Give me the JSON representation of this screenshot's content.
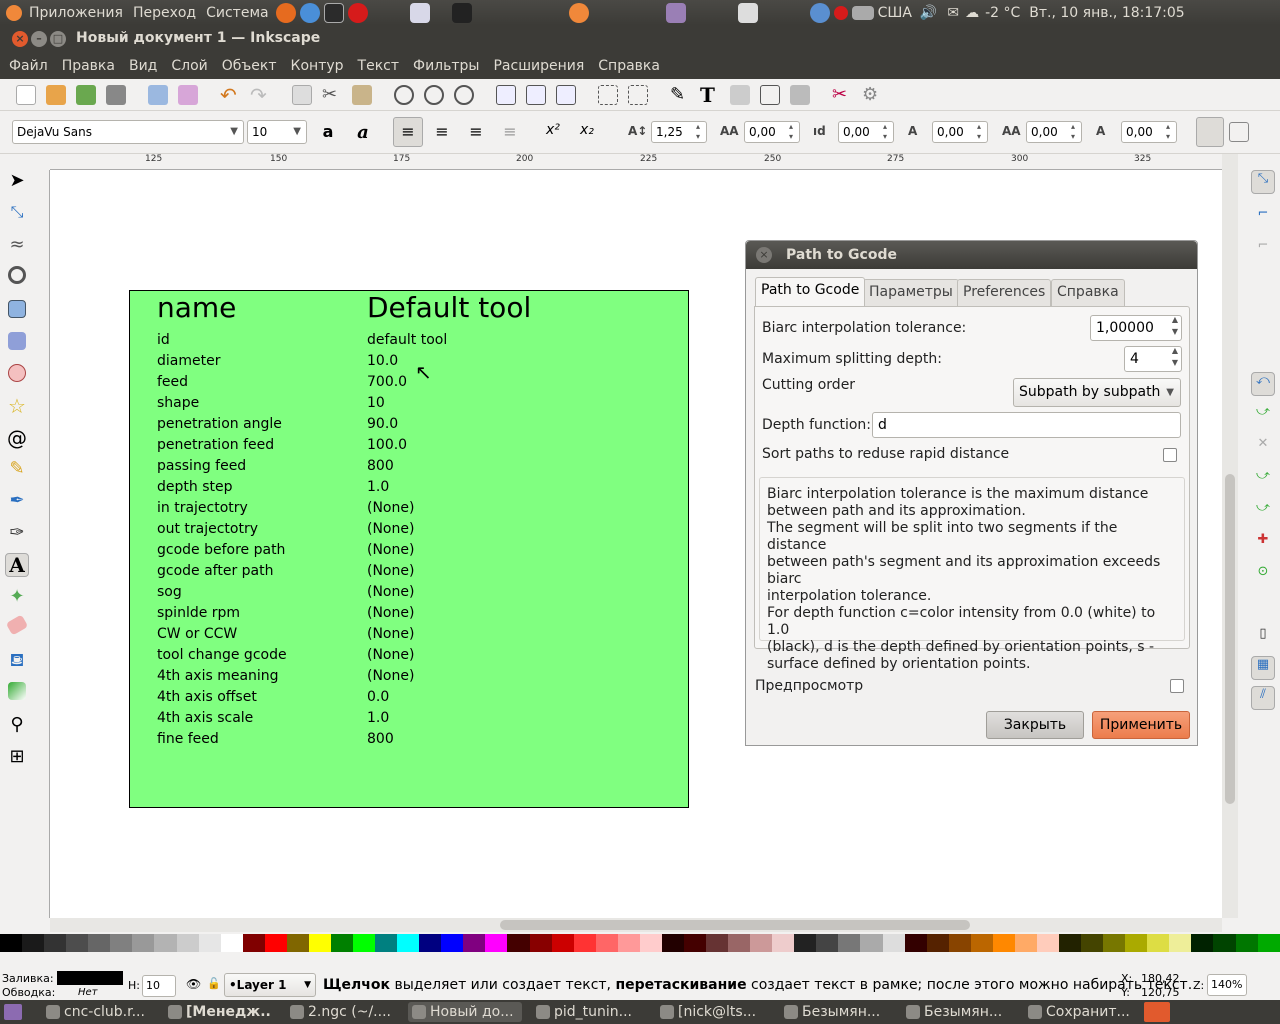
{
  "top_panel": {
    "menus": [
      "Приложения",
      "Переход",
      "Система"
    ],
    "keyboard_layout": "США",
    "weather": "-2 °C",
    "datetime": "Вт., 10 янв., 18:17:05"
  },
  "window": {
    "title": "Новый документ 1 — Inkscape"
  },
  "menubar": [
    "Файл",
    "Правка",
    "Вид",
    "Слой",
    "Объект",
    "Контур",
    "Текст",
    "Фильтры",
    "Расширения",
    "Справка"
  ],
  "textbar": {
    "font_family": "DejaVu Sans",
    "font_size": "10",
    "line_spacing": "1,25",
    "letter_spacing": "0,00",
    "word_spacing": "0,00",
    "kerning": "0,00",
    "vertical_shift": "0,00",
    "rotation": "0,00"
  },
  "ruler_ticks": [
    "125",
    "150",
    "175",
    "200",
    "225",
    "250",
    "275",
    "300",
    "325"
  ],
  "canvas": {
    "header": {
      "name": "name",
      "value": "Default tool"
    },
    "rows": [
      {
        "k": "id",
        "v": "default tool"
      },
      {
        "k": "diameter",
        "v": "10.0"
      },
      {
        "k": "feed",
        "v": "700.0"
      },
      {
        "k": "shape",
        "v": "10"
      },
      {
        "k": "penetration angle",
        "v": "90.0"
      },
      {
        "k": "penetration feed",
        "v": "100.0"
      },
      {
        "k": "passing feed",
        "v": "800"
      },
      {
        "k": "depth step",
        "v": "1.0"
      },
      {
        "k": "in trajectotry",
        "v": "(None)"
      },
      {
        "k": "out trajectotry",
        "v": "(None)"
      },
      {
        "k": "gcode before path",
        "v": "(None)"
      },
      {
        "k": "gcode after path",
        "v": "(None)"
      },
      {
        "k": "sog",
        "v": "(None)"
      },
      {
        "k": "spinlde rpm",
        "v": "(None)"
      },
      {
        "k": "CW or CCW",
        "v": "(None)"
      },
      {
        "k": "tool change gcode",
        "v": "(None)"
      },
      {
        "k": "4th axis meaning",
        "v": "(None)"
      },
      {
        "k": "4th axis offset",
        "v": "0.0"
      },
      {
        "k": "4th axis scale",
        "v": "1.0"
      },
      {
        "k": "fine feed",
        "v": "800"
      }
    ]
  },
  "dialog": {
    "title": "Path to Gcode",
    "tabs": [
      "Path to Gcode",
      "Параметры",
      "Preferences",
      "Справка"
    ],
    "biarc_label": "Biarc interpolation tolerance:",
    "biarc_value": "1,00000",
    "split_label": "Maximum splitting depth:",
    "split_value": "4",
    "order_label": "Cutting order",
    "order_value": "Subpath by subpath",
    "depth_label": "Depth function:",
    "depth_value": "d",
    "sort_label": "Sort paths to reduse rapid distance",
    "help_lines": [
      "Biarc interpolation tolerance is the maximum distance",
      "between path and its approximation.",
      "The segment will be split into two segments if the distance",
      "between path's segment and its approximation exceeds biarc",
      "interpolation tolerance.",
      "For depth function c=color intensity from 0.0 (white) to 1.0",
      "(black), d is the depth defined by orientation points, s -",
      "surface defined by orientation points."
    ],
    "preview_label": "Предпросмотр",
    "close_label": "Закрыть",
    "apply_label": "Применить"
  },
  "status": {
    "fill_label": "Заливка:",
    "stroke_label": "Обводка:",
    "stroke_value": "Нет",
    "opacity_label": "Н:",
    "opacity_value": "10",
    "layer": "•Layer 1",
    "msg_bold1": "Щелчок",
    "msg1": " выделяет или создает текст, ",
    "msg_bold2": "перетаскивание",
    "msg2": " создает текст в рамке; после этого можно набирать текст.",
    "x_label": "X:",
    "x_value": "180,42",
    "y_label": "Y:",
    "y_value": "120,75",
    "zoom_label": "Z:",
    "zoom_value": "140%"
  },
  "taskbar": [
    "cnc-club.r...",
    "[Менедж...",
    "2.ngc (~/....",
    "Новый до...",
    "pid_tunin...",
    "[nick@lts...",
    "Безымян...",
    "Безымян...",
    "Сохранит..."
  ],
  "colors": {
    "canvas_rect": "#80ff80",
    "apply_button": "#f08a5d",
    "panel": "#3c3b37"
  }
}
